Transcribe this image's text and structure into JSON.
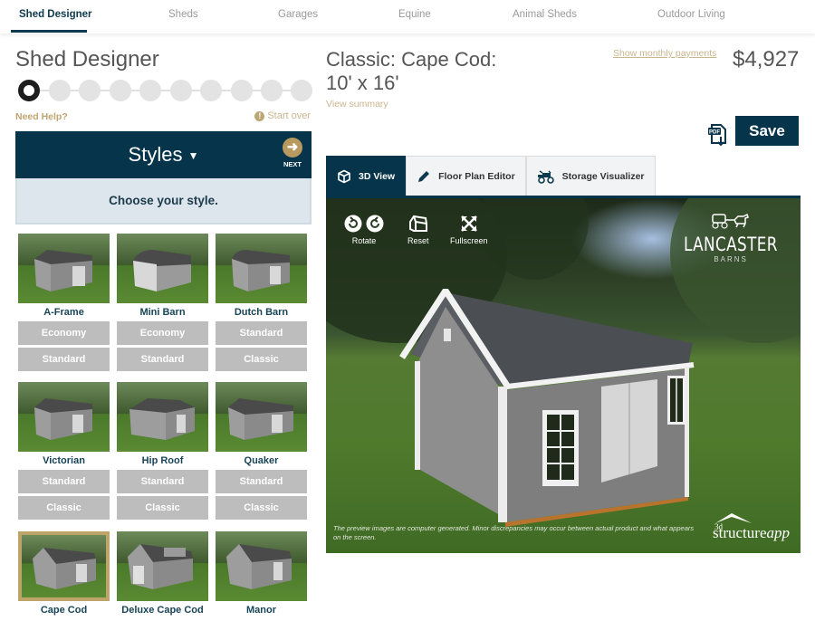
{
  "nav": {
    "items": [
      {
        "label": "Shed Designer",
        "active": true
      },
      {
        "label": "Sheds"
      },
      {
        "label": "Garages"
      },
      {
        "label": "Equine"
      },
      {
        "label": "Animal Sheds"
      },
      {
        "label": "Outdoor Living"
      }
    ]
  },
  "sidebar": {
    "title": "Shed Designer",
    "stepper": {
      "total_steps": 10,
      "current_step": 1
    },
    "need_help": "Need Help?",
    "start_over": "Start over",
    "section_title": "Styles",
    "next_label": "NEXT",
    "instruction": "Choose your style.",
    "styles": [
      {
        "name": "A-Frame",
        "options": [
          "Economy",
          "Standard"
        ]
      },
      {
        "name": "Mini Barn",
        "options": [
          "Economy",
          "Standard"
        ]
      },
      {
        "name": "Dutch Barn",
        "options": [
          "Standard",
          "Classic"
        ]
      },
      {
        "name": "Victorian",
        "options": [
          "Standard",
          "Classic"
        ]
      },
      {
        "name": "Hip Roof",
        "options": [
          "Standard",
          "Classic"
        ]
      },
      {
        "name": "Quaker",
        "options": [
          "Standard",
          "Classic"
        ]
      },
      {
        "name": "Cape Cod",
        "options": [],
        "selected": true
      },
      {
        "name": "Deluxe Cape Cod",
        "options": []
      },
      {
        "name": "Manor",
        "options": []
      }
    ]
  },
  "product": {
    "title_line1": "Classic: Cape Cod:",
    "title_line2": "10' x 16'",
    "view_summary": "View summary",
    "monthly_link": "Show monthly payments",
    "price": "$4,927",
    "save_label": "Save",
    "pdf_icon_label": "PDF"
  },
  "tabs": [
    {
      "label": "3D View",
      "icon": "cube-icon",
      "active": true
    },
    {
      "label": "Floor Plan Editor",
      "icon": "pencil-icon"
    },
    {
      "label": "Storage Visualizer",
      "icon": "tractor-icon"
    }
  ],
  "viewer": {
    "controls": {
      "rotate": "Rotate",
      "reset": "Reset",
      "fullscreen": "Fullscreen"
    },
    "brand_name": "LANCASTER",
    "brand_sub": "BARNS",
    "disclaimer": "The preview images are computer generated. Minor discrepancies may occur between actual product and what appears on the screen.",
    "powered_by_prefix": "3d",
    "powered_by_main": "structure",
    "powered_by_suffix": "app"
  },
  "colors": {
    "primary": "#06354b",
    "accent_gold": "#bfa46a",
    "option_gray": "#bdbdbd"
  }
}
